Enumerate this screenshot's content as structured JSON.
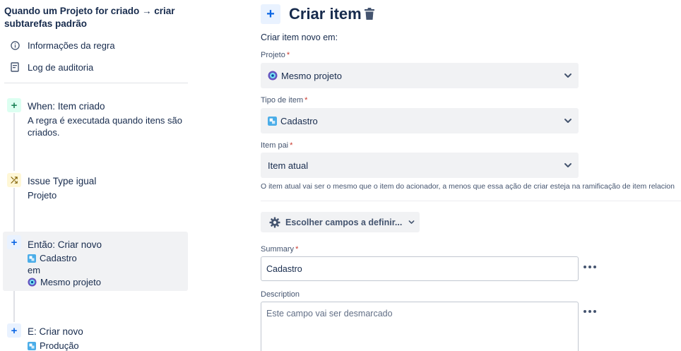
{
  "rule": {
    "title": "Quando um Projeto for criado → criar subtarefas padrão",
    "links": [
      {
        "label": "Informações da regra",
        "icon": "info-icon"
      },
      {
        "label": "Log de auditoria",
        "icon": "audit-log-icon"
      }
    ]
  },
  "steps": [
    {
      "badge": "+",
      "title": "When: Item criado",
      "line1": "A regra é executada quando itens são",
      "line2": "criados."
    },
    {
      "badge": "⤮",
      "title": "Issue Type igual",
      "line1": "Projeto"
    },
    {
      "badge": "+",
      "title": "Então: Criar novo",
      "item": "Cadastro",
      "in": "em",
      "project": "Mesmo projeto"
    },
    {
      "badge": "+",
      "title": "E: Criar novo",
      "item": "Produção"
    }
  ],
  "panel": {
    "add_symbol": "+",
    "title": "Criar item",
    "intro": "Criar item novo em:",
    "required_mark": "*",
    "project": {
      "label": "Projeto",
      "value": "Mesmo projeto"
    },
    "item_type": {
      "label": "Tipo de item",
      "value": "Cadastro"
    },
    "parent": {
      "label": "Item pai",
      "value": "Item atual"
    },
    "help": "O item atual vai ser o mesmo que o item do acionador, a menos que essa ação de criar esteja na ramificação de item relacion",
    "choose_fields": "Escolher campos a definir...",
    "summary": {
      "label": "Summary",
      "value": "Cadastro"
    },
    "description": {
      "label": "Description",
      "placeholder": "Este campo vai ser desmarcado"
    }
  },
  "colors": {
    "accent": "#0c66e4",
    "trigger_green": "#1f845a",
    "condition_yellow": "#7f5f01",
    "required_red": "#c9372c"
  }
}
